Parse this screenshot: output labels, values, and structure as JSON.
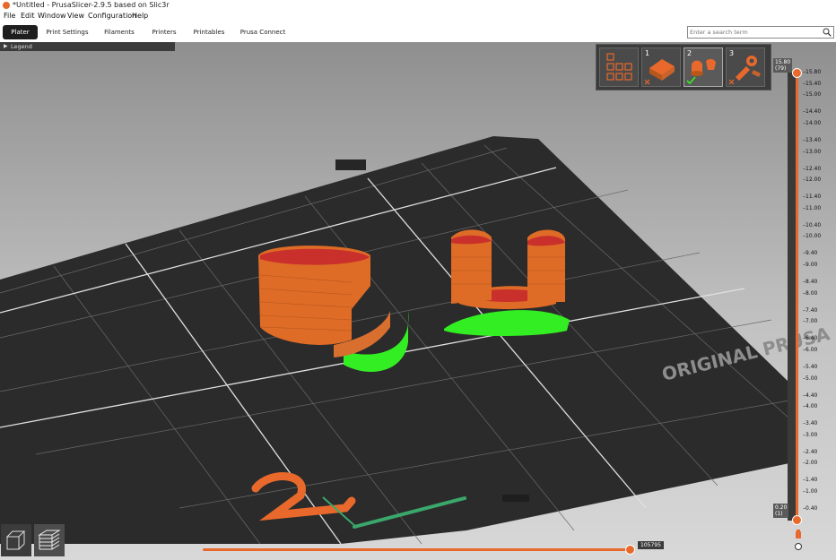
{
  "window": {
    "title": "*Untitled - PrusaSlicer-2.9.5 based on Slic3r"
  },
  "menu": [
    "File",
    "Edit",
    "Window",
    "View",
    "Configuration",
    "Help"
  ],
  "tabs": [
    {
      "label": "Plater",
      "active": true
    },
    {
      "label": "Print Settings",
      "active": false
    },
    {
      "label": "Filaments",
      "active": false
    },
    {
      "label": "Printers",
      "active": false
    },
    {
      "label": "Printables",
      "active": false
    },
    {
      "label": "Prusa Connect",
      "active": false
    }
  ],
  "search": {
    "placeholder": "Enter a search term",
    "icon": "search-icon"
  },
  "legend": {
    "label": "Legend"
  },
  "objects": [
    {
      "number": "",
      "icon": "grid-icon"
    },
    {
      "number": "1",
      "icon": "x-mark-icon"
    },
    {
      "number": "2",
      "icon": "checkmark-icon"
    },
    {
      "number": "3",
      "icon": "x-mark-icon"
    }
  ],
  "bed": {
    "label": "ORIGINAL PRUSA"
  },
  "layer_slider": {
    "top_value": "15.80",
    "top_layer": "(79)",
    "bottom_value": "0.20",
    "bottom_layer": "(1)",
    "ticks": [
      "15.80",
      "15.40",
      "15.00",
      "14.40",
      "14.00",
      "13.40",
      "13.00",
      "12.40",
      "12.00",
      "11.40",
      "11.00",
      "10.40",
      "10.00",
      "9.40",
      "9.00",
      "8.40",
      "8.00",
      "7.40",
      "7.00",
      "6.40",
      "6.00",
      "5.40",
      "5.00",
      "4.40",
      "4.00",
      "3.40",
      "3.00",
      "2.40",
      "2.00",
      "1.40",
      "1.00",
      "0.40"
    ]
  },
  "move_slider": {
    "value": "105795"
  },
  "colors": {
    "accent": "#e8692b",
    "support": "#33ee22",
    "bed": "#2d2d2d",
    "grid": "#6a6a6a"
  }
}
